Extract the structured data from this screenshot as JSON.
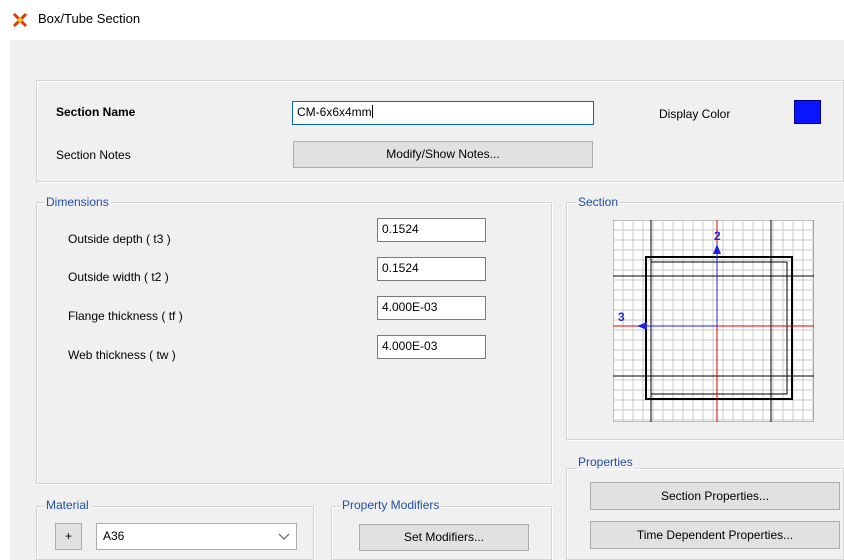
{
  "window": {
    "title": "Box/Tube Section"
  },
  "header": {
    "section_name_label": "Section Name",
    "section_name_value": "CM-6x6x4mm",
    "display_color_label": "Display Color",
    "display_color": "#0a14ff",
    "section_notes_label": "Section Notes",
    "modify_notes_button": "Modify/Show Notes..."
  },
  "dimensions": {
    "group_label": "Dimensions",
    "fields": [
      {
        "label": "Outside depth  ( t3 )",
        "value": "0.1524"
      },
      {
        "label": "Outside width  ( t2 )",
        "value": "0.1524"
      },
      {
        "label": "Flange thickness  ( tf )",
        "value": "4.000E-03"
      },
      {
        "label": "Web thickness  ( tw )",
        "value": "4.000E-03"
      }
    ]
  },
  "section_preview": {
    "group_label": "Section",
    "axis_vertical_label": "2",
    "axis_horizontal_label": "3",
    "axis_color": "#2222dd",
    "center_line_color": "#e00000"
  },
  "properties": {
    "group_label": "Properties",
    "section_properties_button": "Section Properties...",
    "time_dependent_button": "Time Dependent Properties..."
  },
  "material": {
    "group_label": "Material",
    "add_button": "+",
    "selected": "A36"
  },
  "property_modifiers": {
    "group_label": "Property Modifiers",
    "set_modifiers_button": "Set Modifiers..."
  }
}
